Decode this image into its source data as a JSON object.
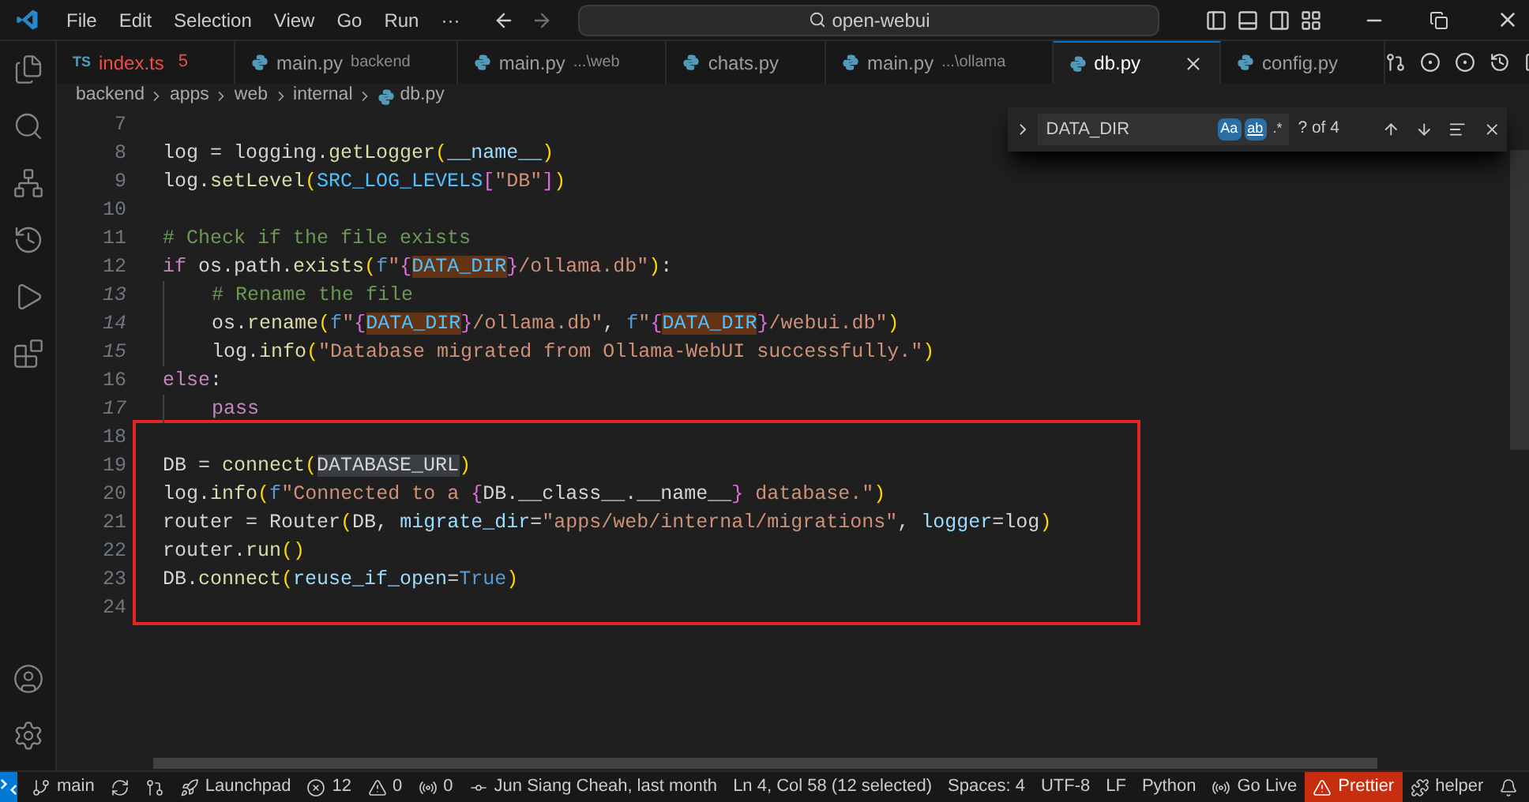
{
  "title_bar": {
    "menus": [
      "File",
      "Edit",
      "Selection",
      "View",
      "Go",
      "Run",
      "···"
    ],
    "command_center": "open-webui"
  },
  "tabs": [
    {
      "kind": "ts",
      "icon_text": "TS",
      "name": "index.ts",
      "badge": "5",
      "has_errors": true,
      "selected": false
    },
    {
      "kind": "python",
      "name": "main.py",
      "detail": "backend",
      "has_errors": false,
      "selected": false
    },
    {
      "kind": "python",
      "name": "main.py",
      "detail": "...\\web",
      "has_errors": false,
      "selected": false
    },
    {
      "kind": "python",
      "name": "chats.py",
      "has_errors": false,
      "selected": false
    },
    {
      "kind": "python",
      "name": "main.py",
      "detail": "...\\ollama",
      "has_errors": false,
      "selected": false
    },
    {
      "kind": "python",
      "name": "db.py",
      "has_errors": false,
      "selected": true
    },
    {
      "kind": "python",
      "name": "config.py",
      "has_errors": false,
      "selected": false
    }
  ],
  "breadcrumb": [
    "backend",
    "apps",
    "web",
    "internal",
    "db.py"
  ],
  "find_widget": {
    "query": "DATA_DIR",
    "toggles": [
      {
        "kind": "case",
        "label": "Aa",
        "on": true
      },
      {
        "kind": "word",
        "label": "ab",
        "on": true
      },
      {
        "kind": "regex",
        "label": ".*",
        "on": false
      }
    ],
    "result": "? of 4"
  },
  "code_blocks": [
    {
      "boxed": false,
      "lines": [
        {
          "number": "7",
          "indented": false
        },
        {
          "number": "8",
          "indented": false,
          "tokens": [
            {
              "t": "log = logging.",
              "kind": "text"
            },
            {
              "t": "getLogger",
              "kind": "function"
            },
            {
              "t": "(",
              "kind": "bracket1"
            },
            {
              "t": "__name__",
              "kind": "variable"
            },
            {
              "t": ")",
              "kind": "bracket1"
            }
          ]
        },
        {
          "number": "9",
          "indented": false,
          "tokens": [
            {
              "t": "log.",
              "kind": "text"
            },
            {
              "t": "setLevel",
              "kind": "function"
            },
            {
              "t": "(",
              "kind": "bracket1"
            },
            {
              "t": "SRC_LOG_LEVELS",
              "kind": "constant"
            },
            {
              "t": "[",
              "kind": "bracket2"
            },
            {
              "t": "\"DB\"",
              "kind": "string"
            },
            {
              "t": "]",
              "kind": "bracket2"
            },
            {
              "t": ")",
              "kind": "bracket1"
            }
          ]
        },
        {
          "number": "10",
          "indented": false
        },
        {
          "number": "11",
          "indented": false,
          "tokens": [
            {
              "t": "# Check if the file exists",
              "kind": "comment"
            }
          ]
        },
        {
          "number": "12",
          "indented": false,
          "tokens": [
            {
              "t": "if",
              "kind": "keyword"
            },
            {
              "t": " os.path.",
              "kind": "text"
            },
            {
              "t": "exists",
              "kind": "function"
            },
            {
              "t": "(",
              "kind": "bracket1"
            },
            {
              "t": "f",
              "kind": "storage"
            },
            {
              "t": "\"",
              "kind": "string"
            },
            {
              "t": "{",
              "kind": "bracket2"
            },
            {
              "t": "DATA_DIR",
              "kind": "constant",
              "find_match": true
            },
            {
              "t": "}",
              "kind": "bracket2"
            },
            {
              "t": "/ollama.db\"",
              "kind": "string"
            },
            {
              "t": ")",
              "kind": "bracket1"
            },
            {
              "t": ":",
              "kind": "text"
            }
          ]
        },
        {
          "number": "13",
          "indented": true,
          "tokens": [
            {
              "t": "# Rename the file",
              "kind": "comment"
            }
          ]
        },
        {
          "number": "14",
          "indented": true,
          "tokens": [
            {
              "t": "os.",
              "kind": "text"
            },
            {
              "t": "rename",
              "kind": "function"
            },
            {
              "t": "(",
              "kind": "bracket1"
            },
            {
              "t": "f",
              "kind": "storage"
            },
            {
              "t": "\"",
              "kind": "string"
            },
            {
              "t": "{",
              "kind": "bracket2"
            },
            {
              "t": "DATA_DIR",
              "kind": "constant",
              "find_match": true
            },
            {
              "t": "}",
              "kind": "bracket2"
            },
            {
              "t": "/ollama.db\"",
              "kind": "string"
            },
            {
              "t": ", ",
              "kind": "text"
            },
            {
              "t": "f",
              "kind": "storage"
            },
            {
              "t": "\"",
              "kind": "string"
            },
            {
              "t": "{",
              "kind": "bracket2"
            },
            {
              "t": "DATA_DIR",
              "kind": "constant",
              "find_match": true
            },
            {
              "t": "}",
              "kind": "bracket2"
            },
            {
              "t": "/webui.db\"",
              "kind": "string"
            },
            {
              "t": ")",
              "kind": "bracket1"
            }
          ]
        },
        {
          "number": "15",
          "indented": true,
          "tokens": [
            {
              "t": "log.",
              "kind": "text"
            },
            {
              "t": "info",
              "kind": "function"
            },
            {
              "t": "(",
              "kind": "bracket1"
            },
            {
              "t": "\"Database migrated from Ollama-WebUI successfully.\"",
              "kind": "string"
            },
            {
              "t": ")",
              "kind": "bracket1"
            }
          ]
        },
        {
          "number": "16",
          "indented": false,
          "tokens": [
            {
              "t": "else",
              "kind": "keyword"
            },
            {
              "t": ":",
              "kind": "text"
            }
          ]
        },
        {
          "number": "17",
          "indented": true,
          "tokens": [
            {
              "t": "pass",
              "kind": "keyword"
            }
          ]
        }
      ]
    },
    {
      "boxed": true,
      "lines": [
        {
          "number": "18",
          "indented": false
        },
        {
          "number": "19",
          "indented": false,
          "tokens": [
            {
              "t": "DB = ",
              "kind": "text"
            },
            {
              "t": "connect",
              "kind": "function"
            },
            {
              "t": "(",
              "kind": "bracket1"
            },
            {
              "t": "DATABASE_URL",
              "kind": "text",
              "selected": true
            },
            {
              "t": ")",
              "kind": "bracket1"
            }
          ]
        },
        {
          "number": "20",
          "indented": false,
          "tokens": [
            {
              "t": "log.",
              "kind": "text"
            },
            {
              "t": "info",
              "kind": "function"
            },
            {
              "t": "(",
              "kind": "bracket1"
            },
            {
              "t": "f",
              "kind": "storage"
            },
            {
              "t": "\"Connected to a ",
              "kind": "string"
            },
            {
              "t": "{",
              "kind": "bracket2"
            },
            {
              "t": "DB.__class__.__name__",
              "kind": "text"
            },
            {
              "t": "}",
              "kind": "bracket2"
            },
            {
              "t": " database.\"",
              "kind": "string"
            },
            {
              "t": ")",
              "kind": "bracket1"
            }
          ]
        },
        {
          "number": "21",
          "indented": false,
          "tokens": [
            {
              "t": "router = Router",
              "kind": "text"
            },
            {
              "t": "(",
              "kind": "bracket1"
            },
            {
              "t": "DB, ",
              "kind": "text"
            },
            {
              "t": "migrate_dir",
              "kind": "variable"
            },
            {
              "t": "=",
              "kind": "text"
            },
            {
              "t": "\"apps/web/internal/migrations\"",
              "kind": "string"
            },
            {
              "t": ", ",
              "kind": "text"
            },
            {
              "t": "logger",
              "kind": "variable"
            },
            {
              "t": "=log",
              "kind": "text"
            },
            {
              "t": ")",
              "kind": "bracket1"
            }
          ]
        },
        {
          "number": "22",
          "indented": false,
          "tokens": [
            {
              "t": "router.",
              "kind": "text"
            },
            {
              "t": "run",
              "kind": "function"
            },
            {
              "t": "()",
              "kind": "bracket1"
            }
          ]
        },
        {
          "number": "23",
          "indented": false,
          "tokens": [
            {
              "t": "DB.",
              "kind": "text"
            },
            {
              "t": "connect",
              "kind": "function"
            },
            {
              "t": "(",
              "kind": "bracket1"
            },
            {
              "t": "reuse_if_open",
              "kind": "variable"
            },
            {
              "t": "=",
              "kind": "text"
            },
            {
              "t": "True",
              "kind": "storage"
            },
            {
              "t": ")",
              "kind": "bracket1"
            }
          ]
        },
        {
          "number": "24",
          "indented": false
        }
      ]
    }
  ],
  "status_bar": {
    "left": [
      {
        "kind": "branch",
        "text": "main"
      },
      {
        "kind": "sync"
      },
      {
        "kind": "graph"
      },
      {
        "kind": "launchpad",
        "text": "Launchpad"
      },
      {
        "kind": "errors",
        "text": "12"
      },
      {
        "kind": "warnings",
        "text": "0"
      },
      {
        "kind": "ports",
        "text": "0"
      }
    ],
    "right": [
      {
        "kind": "blame",
        "text": "Jun Siang Cheah, last month",
        "alert": false
      },
      {
        "kind": "text",
        "text": "Ln 4, Col 58 (12 selected)",
        "alert": false
      },
      {
        "kind": "text",
        "text": "Spaces: 4",
        "alert": false
      },
      {
        "kind": "text",
        "text": "UTF-8",
        "alert": false
      },
      {
        "kind": "text",
        "text": "LF",
        "alert": false
      },
      {
        "kind": "text",
        "text": "Python",
        "alert": false
      },
      {
        "kind": "golive",
        "text": "Go Live",
        "alert": false
      },
      {
        "kind": "prettier",
        "text": "Prettier",
        "alert": true
      },
      {
        "kind": "helper",
        "text": "helper",
        "alert": false
      },
      {
        "kind": "bell",
        "alert": false
      }
    ]
  }
}
